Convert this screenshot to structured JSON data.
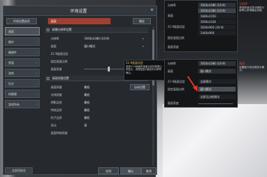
{
  "window": {
    "title": "环境设置",
    "close": "✕"
  },
  "tabs": {
    "left": "环境设置选项",
    "right": "画面",
    "top_button": "确定"
  },
  "sidebar": {
    "items": [
      {
        "label": "画面",
        "active": true
      },
      {
        "label": "操作",
        "active": false
      },
      {
        "label": "硬键件",
        "active": false
      },
      {
        "label": "界面",
        "active": false
      },
      {
        "label": "游戏",
        "active": false
      },
      {
        "label": "社交",
        "active": false
      },
      {
        "label": "快捷键",
        "active": false
      },
      {
        "label": "游戏所有",
        "active": false
      }
    ],
    "bottom_button": "全部初始化"
  },
  "content": {
    "section1": "屏幕分辨率设置",
    "rows1": [
      {
        "label": "分辨率",
        "value": "1920x1080 (16:9)"
      },
      {
        "label": "画面",
        "value": "窗口模式"
      },
      {
        "label": "21:9画面设定",
        "value": ""
      },
      {
        "label": "固定画面比例",
        "value": ""
      },
      {
        "label": "画面亮度",
        "value": "",
        "pct": "50%"
      }
    ],
    "section2": "画面质量设置",
    "rows2": [
      {
        "label": "画面质量",
        "value": "最低"
      },
      {
        "label": "光线质量",
        "value": "最低"
      },
      {
        "label": "阴影品质",
        "value": "最低"
      },
      {
        "label": "特效品质",
        "value": "最低"
      },
      {
        "label": "粒子品质",
        "value": "最低"
      },
      {
        "label": "多边",
        "value": "高"
      },
      {
        "label": "画面特效质量",
        "value": ""
      }
    ],
    "auto_button": "自动设置"
  },
  "footer": {
    "apply": "应用",
    "confirm": "确认",
    "cancel": "取消"
  },
  "tooltip": {
    "title": "21:9画面设定",
    "body": "选择21:9画面时画面对应的宽屏比例显示，请根据显示器实际分辨率确认。"
  },
  "res_panel": {
    "label1": "分辨率",
    "selected": "1920x1080 (16:9)",
    "label2": "画面",
    "label3": "21:9画面设定",
    "label4": "固定画面比例",
    "label5": "画面亮度",
    "options": [
      "1920x1080 (16:9)",
      "1680x1050",
      "1600x1024",
      "1600x900 (16:9)",
      "1440x900"
    ]
  },
  "mode_panel": {
    "label1": "分辨率",
    "value1": "1920x1080 (16:9)",
    "label2": "画面",
    "value2": "窗口模式",
    "label3": "21:9画面设定",
    "label4": "固定画面比例",
    "label5": "画面亮度",
    "options": [
      "全屏模式",
      "窗口模式",
      "全屏无边框模式"
    ],
    "highlight_index": 1
  },
  "right_note_top": {
    "title": "分辨率",
    "body": "请选择适合显示器的分辨率以获得最佳效果。"
  },
  "right_note_mid": {
    "title": "画面",
    "body": "设置窗口或全屏显示模式。"
  },
  "colors": {
    "accent_red": "#a04030",
    "arrow_red": "#e0382a",
    "tooltip_title": "#f2c24b"
  }
}
